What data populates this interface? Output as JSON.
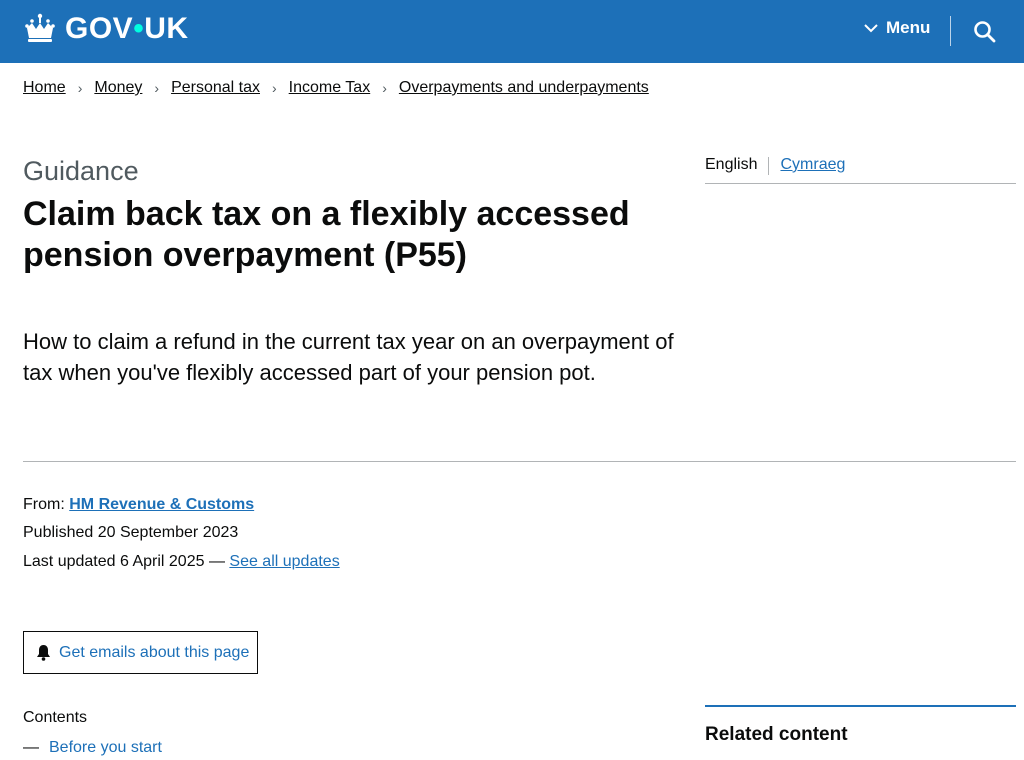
{
  "header": {
    "logo_text_gov": "GOV",
    "logo_dot": "•",
    "logo_text_uk": "UK",
    "menu_label": "Menu",
    "brand_color": "#1d70b8",
    "icons": [
      "crown-icon",
      "chevron-down-icon",
      "search-icon"
    ]
  },
  "breadcrumb": {
    "items": [
      "Home",
      "Money",
      "Personal tax",
      "Income Tax",
      "Overpayments and underpayments"
    ]
  },
  "page": {
    "caption": "Guidance",
    "title": "Claim back tax on a flexibly accessed pension overpayment (P55)",
    "lede": "How to claim a refund in the current tax year on an overpayment of tax when you've flexibly accessed part of your pension pot."
  },
  "language": {
    "current": "English",
    "alternate": "Cymraeg"
  },
  "metadata": {
    "from_label": "From:",
    "from_org": "HM Revenue & Customs",
    "published_label": "Published",
    "published_date": "20 September 2023",
    "updated_label": "Last updated",
    "updated_date": "6 April 2025 —",
    "see_updates": "See all updates"
  },
  "email_button": {
    "label": "Get emails about this page",
    "icon": "bell-icon"
  },
  "contents": {
    "label": "Contents",
    "dash": "—",
    "items": [
      "Before you start"
    ]
  },
  "related": {
    "title": "Related content"
  },
  "colors": {
    "link": "#1d70b8",
    "text": "#0b0c0c",
    "secondary_text": "#505a5f",
    "border": "#b1b4b6"
  }
}
